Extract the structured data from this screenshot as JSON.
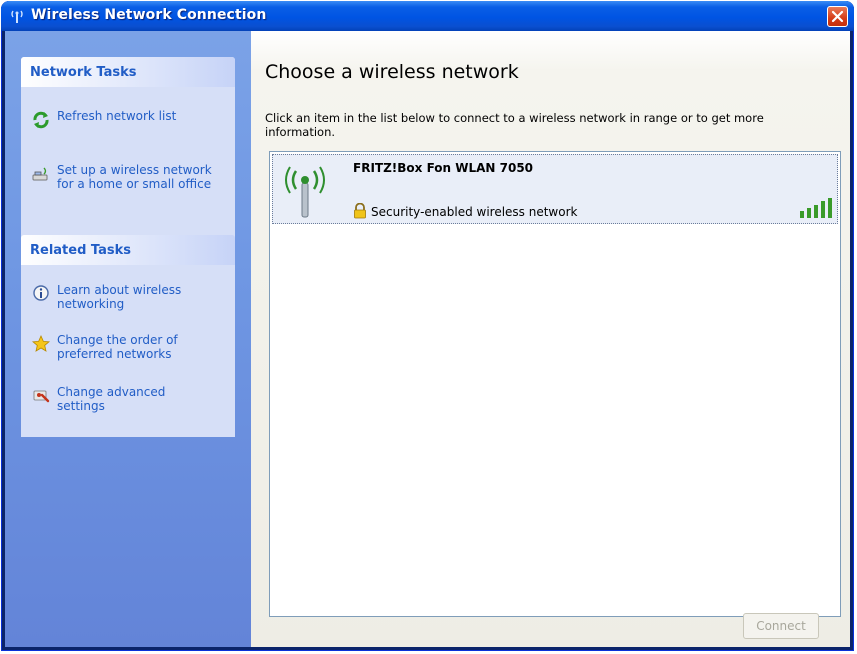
{
  "window": {
    "title": "Wireless Network Connection",
    "icons": {
      "title": "wireless-network-icon",
      "close": "close-icon"
    }
  },
  "sidebar": {
    "network_tasks": {
      "header": "Network Tasks",
      "items": [
        {
          "label": "Refresh network list",
          "icon": "refresh-icon"
        },
        {
          "label": "Set up a wireless network for a home or small office",
          "icon": "setup-network-icon"
        }
      ]
    },
    "related_tasks": {
      "header": "Related Tasks",
      "items": [
        {
          "label": "Learn about wireless networking",
          "icon": "info-icon"
        },
        {
          "label": "Change the order of preferred networks",
          "icon": "star-icon"
        },
        {
          "label": "Change advanced settings",
          "icon": "settings-icon"
        }
      ]
    }
  },
  "main": {
    "title": "Choose a wireless network",
    "description": "Click an item in the list below to connect to a wireless network in range or to get more information.",
    "networks": [
      {
        "name": "FRITZ!Box Fon WLAN 7050",
        "status": "Security-enabled wireless network",
        "signal_bars": 5,
        "icon": "wireless-antenna-icon",
        "security_icon": "lock-icon"
      }
    ],
    "connect_label": "Connect"
  },
  "colors": {
    "titlebar": "#0054e3",
    "sidebar": "#6f97e3",
    "link": "#215dc6",
    "signal": "#3a9b2a"
  }
}
